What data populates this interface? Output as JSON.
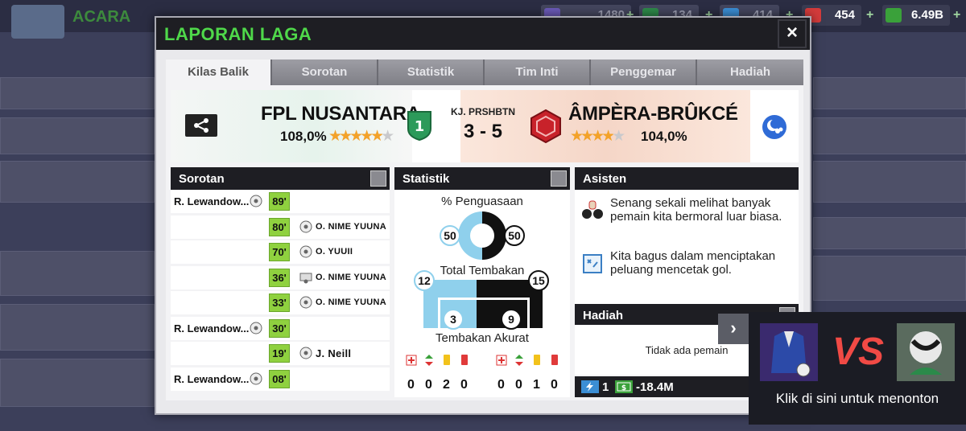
{
  "background": {
    "club_name": "ACARA",
    "currencies": [
      {
        "value": "1480",
        "color": "#6b5ab8"
      },
      {
        "value": "134",
        "color": "#2e8a4a"
      },
      {
        "value": "414",
        "color": "#3b8ed4"
      },
      {
        "value": "454",
        "color": "#d43b3b"
      },
      {
        "value": "6.49B",
        "color": "#3aa13a"
      }
    ]
  },
  "dialog": {
    "title": "LAPORAN LAGA",
    "close_icon": "×",
    "tabs": [
      "Kilas Balik",
      "Sorotan",
      "Statistik",
      "Tim Inti",
      "Penggemar",
      "Hadiah"
    ],
    "active_tab": "Kilas Balik"
  },
  "match": {
    "home": {
      "name": "FPL NUSANTARA",
      "rating": "108,0%",
      "stars": 5
    },
    "away": {
      "name": "ÂMPÈRA-BRÛKCÉ",
      "rating": "104,0%",
      "stars": 4
    },
    "venue": "KJ. PRSHBTN",
    "score": "3 - 5",
    "colors": {
      "home_badge": "#2c9a5a",
      "away_badge": "#c8222a",
      "weather": "#2f6bd6"
    }
  },
  "highlights": {
    "header": "Sorotan",
    "rows": [
      {
        "home_player": "R. Lewandow...",
        "minute": "89'",
        "away_player": ""
      },
      {
        "home_player": "",
        "minute": "80'",
        "away_player": "O. NIME YUUNA"
      },
      {
        "home_player": "",
        "minute": "70'",
        "away_player": "O. YUUII"
      },
      {
        "home_player": "",
        "minute": "36'",
        "away_player": "O. NIME YUUNA"
      },
      {
        "home_player": "",
        "minute": "33'",
        "away_player": "O. NIME YUUNA"
      },
      {
        "home_player": "R. Lewandow...",
        "minute": "30'",
        "away_player": ""
      },
      {
        "home_player": "",
        "minute": "19'",
        "away_player": "J. Neill"
      },
      {
        "home_player": "R. Lewandow...",
        "minute": "08'",
        "away_player": ""
      }
    ]
  },
  "stats": {
    "header": "Statistik",
    "possession_label": "% Penguasaan",
    "possession": {
      "home": 50,
      "away": 50
    },
    "shots_label": "Total Tembakan",
    "shots": {
      "home": 12,
      "away": 15
    },
    "on_target_label": "Tembakan Akurat",
    "on_target": {
      "home": 3,
      "away": 9
    },
    "home_cards": [
      "0",
      "0",
      "2",
      "0"
    ],
    "away_cards": [
      "0",
      "0",
      "1",
      "0"
    ],
    "colors": {
      "home": "#8fd0ec",
      "away": "#111111"
    }
  },
  "assistant": {
    "header": "Asisten",
    "messages": [
      {
        "icon": "dumbbell-icon",
        "text": "Senang sekali melihat banyak pemain kita bermoral luar biasa."
      },
      {
        "icon": "tactics-board-icon",
        "text": "Kita bagus dalam menciptakan peluang mencetak gol."
      }
    ]
  },
  "rewards": {
    "header": "Hadiah",
    "empty_text": "Tidak ada pemain",
    "energy": "1",
    "money": "-18.4M"
  },
  "replay": {
    "vs": "VS",
    "label": "Klik di sini untuk menonton",
    "arrow": "›"
  }
}
